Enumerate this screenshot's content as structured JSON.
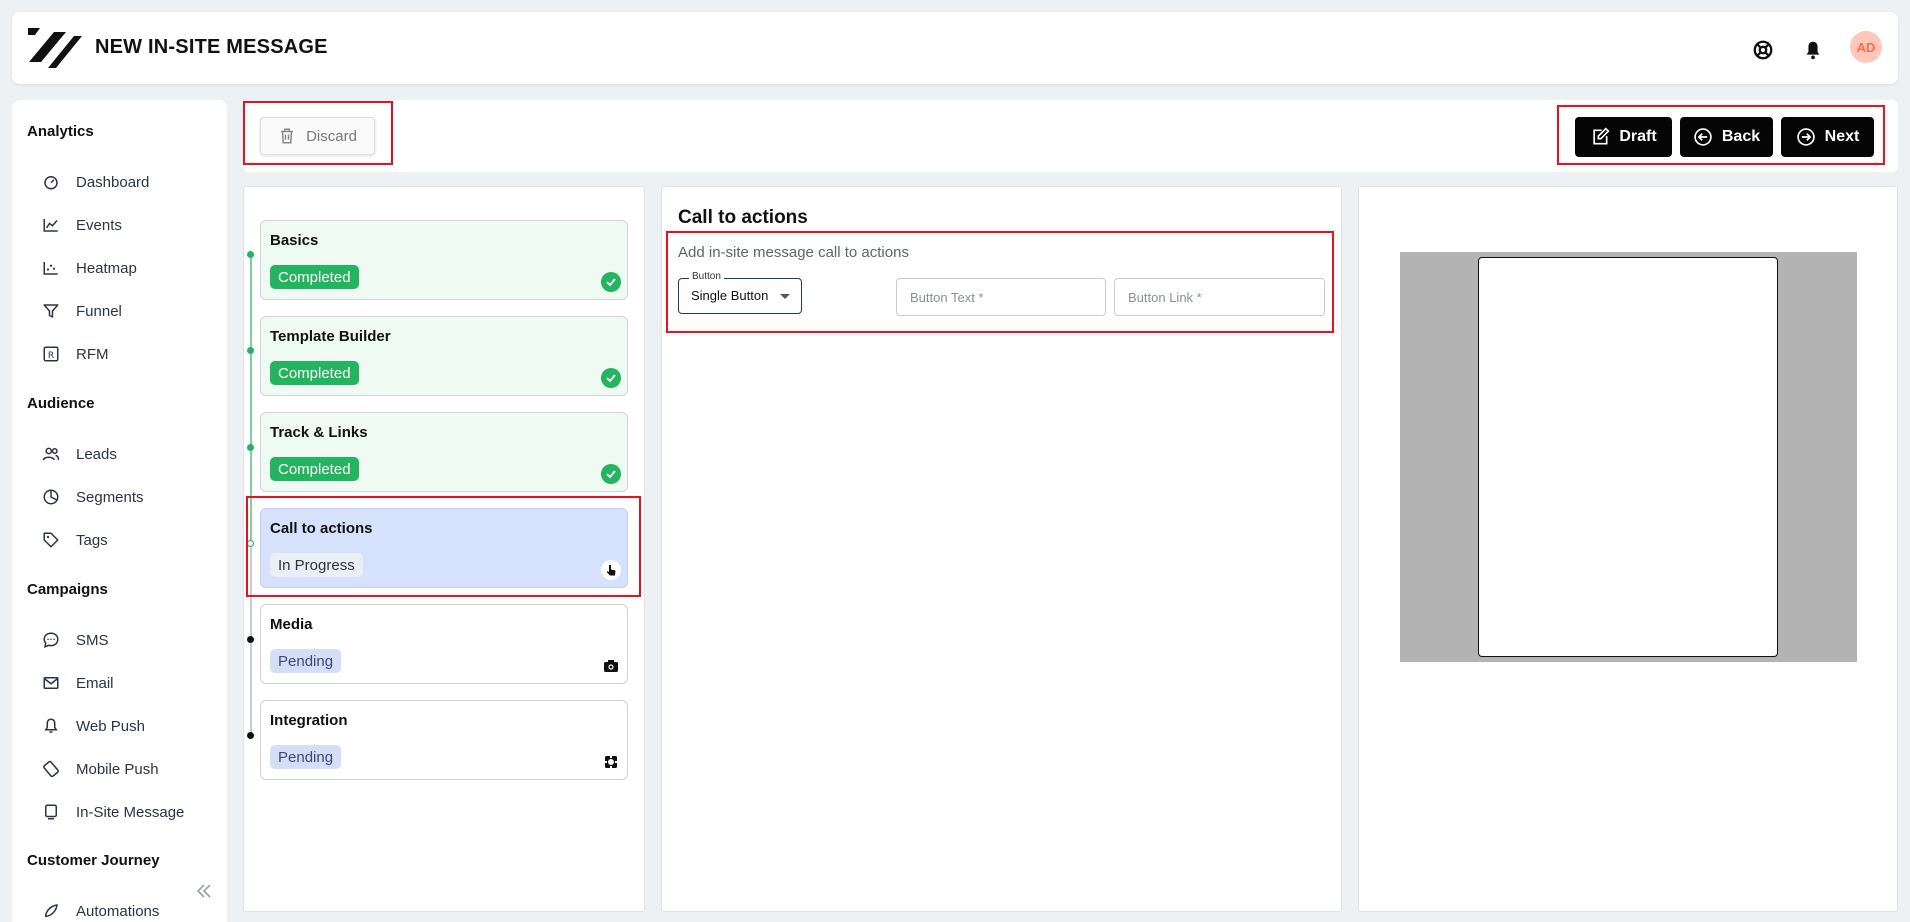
{
  "header": {
    "title": "NEW IN-SITE MESSAGE",
    "avatar_initials": "AD",
    "icons": [
      "support-icon",
      "bell-icon"
    ],
    "accent_color": "#ff6a4d"
  },
  "sidebar": {
    "sections": {
      "analytics": "Analytics",
      "audience": "Audience",
      "campaigns": "Campaigns",
      "journey": "Customer Journey"
    },
    "items": {
      "dashboard": "Dashboard",
      "events": "Events",
      "heatmap": "Heatmap",
      "funnel": "Funnel",
      "rfm": "RFM",
      "leads": "Leads",
      "segments": "Segments",
      "tags": "Tags",
      "sms": "SMS",
      "email": "Email",
      "webpush": "Web Push",
      "mobilepush": "Mobile Push",
      "insite": "In-Site Message",
      "automations": "Automations"
    }
  },
  "toolbar": {
    "discard": "Discard",
    "draft": "Draft",
    "back": "Back",
    "next": "Next"
  },
  "steps": [
    {
      "title": "Basics",
      "status": "Completed"
    },
    {
      "title": "Template Builder",
      "status": "Completed"
    },
    {
      "title": "Track & Links",
      "status": "Completed"
    },
    {
      "title": "Call to actions",
      "status": "In Progress"
    },
    {
      "title": "Media",
      "status": "Pending"
    },
    {
      "title": "Integration",
      "status": "Pending"
    }
  ],
  "cta": {
    "title": "Call to actions",
    "subtitle": "Add in-site message call to actions",
    "button_select_label": "Button",
    "button_select_value": "Single Button",
    "button_text_placeholder": "Button Text *",
    "button_link_placeholder": "Button Link *"
  },
  "colors": {
    "completed": "#24b35f",
    "active_step": "#d6e2fb",
    "highlight": "#e8121e"
  }
}
